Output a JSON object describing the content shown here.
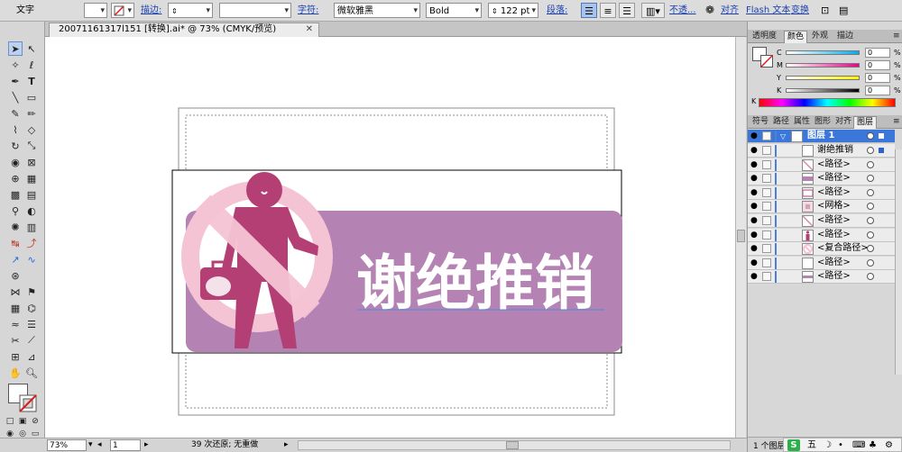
{
  "control_bar": {
    "mode_label": "文字",
    "stroke_label": "描边:",
    "char_label": "字符:",
    "font_family": "微软雅黑",
    "font_style": "Bold",
    "font_size": "122 pt",
    "paragraph_label": "段落:",
    "opacity_label": "不透...",
    "align_label": "对齐",
    "flash_text_label": "Flash 文本",
    "transform_label": "变换"
  },
  "document": {
    "tab_title": "20071161317l151 [转换].ai* @ 73% (CMYK/预览)",
    "close_symbol": "✕"
  },
  "artwork": {
    "sign_text": "谢绝推销",
    "circle_color": "#f5c4d4",
    "figure_color": "#b43f74",
    "banner_color": "#b483b4"
  },
  "status_bar": {
    "zoom": "73%",
    "page": "1",
    "message": "39 次还原; 无重做"
  },
  "color_panel": {
    "tabs": [
      "透明度",
      "颜色",
      "外观",
      "描边"
    ],
    "active_tab": "颜色",
    "channels": [
      {
        "label": "C",
        "value": "0",
        "unit": "%",
        "gradient": "linear-gradient(to right,#fff,#00aeef)"
      },
      {
        "label": "M",
        "value": "0",
        "unit": "%",
        "gradient": "linear-gradient(to right,#fff,#ec008c)"
      },
      {
        "label": "Y",
        "value": "0",
        "unit": "%",
        "gradient": "linear-gradient(to right,#fff,#fff200)"
      },
      {
        "label": "K",
        "value": "0",
        "unit": "%",
        "gradient": "linear-gradient(to right,#fff,#000)"
      }
    ],
    "spectrum_label": "K"
  },
  "layers_panel": {
    "tabs": [
      "符号",
      "路径",
      "属性",
      "图形",
      "对齐",
      "图层"
    ],
    "active_tab": "图层",
    "layer_name": "图层 1",
    "items": [
      {
        "name": "谢绝推销",
        "kind": "text"
      },
      {
        "name": "<路径>",
        "kind": "line"
      },
      {
        "name": "<路径>",
        "kind": "bar"
      },
      {
        "name": "<路径>",
        "kind": "bar2"
      },
      {
        "name": "<网格>",
        "kind": "grid"
      },
      {
        "name": "<路径>",
        "kind": "line"
      },
      {
        "name": "<路径>",
        "kind": "figure"
      },
      {
        "name": "<复合路径>",
        "kind": "compound"
      },
      {
        "name": "<路径>",
        "kind": "plain"
      },
      {
        "name": "<路径>",
        "kind": "strip"
      }
    ],
    "footer": "1 个图层"
  },
  "ime_bar": {
    "brand": "S",
    "mode": "五"
  }
}
